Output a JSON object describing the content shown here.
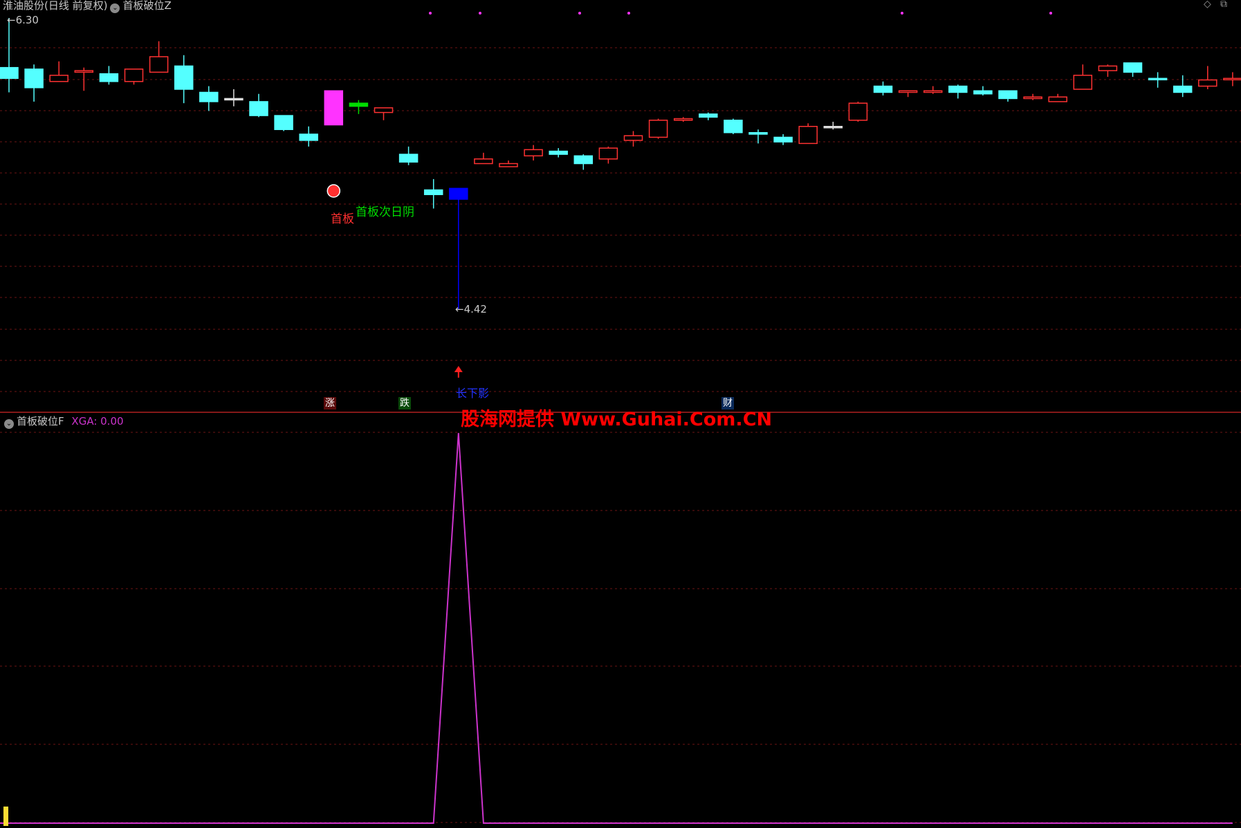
{
  "main_panel": {
    "stock_title": "淮油股份(日线 前复权)",
    "indicator_name": "首板破位Z",
    "high_label": "6.30",
    "low_label": "4.42",
    "annotations": {
      "first_board": "首板",
      "next_day_down": "首板次日阴",
      "long_lower_shadow": "长下影"
    },
    "event_tags": {
      "up": "涨",
      "down": "跌",
      "finance": "财"
    }
  },
  "sub_panel": {
    "indicator_name": "首板破位F",
    "value_label": "XGA: 0.00"
  },
  "watermark": "股海网提供 Www.Guhai.Com.CN",
  "colors": {
    "background": "#000000",
    "up_candle": "#ff3232",
    "down_candle": "#54ffff",
    "limit_up_board": "#ff33ff",
    "next_day_down": "#00dd00",
    "long_shadow": "#0000ff",
    "indicator_line": "#cc33cc",
    "grid": "#8b1a1a",
    "watermark": "#ff0000"
  },
  "chart_data": [
    {
      "type": "candlestick",
      "title": "淮油股份(日线 前复权)",
      "price_range": [
        4.42,
        6.3
      ],
      "grid": true,
      "candles": [
        {
          "o": 5.98,
          "c": 5.91,
          "h": 6.3,
          "l": 5.82,
          "color": "cyan"
        },
        {
          "o": 5.97,
          "c": 5.85,
          "h": 6.0,
          "l": 5.76,
          "color": "cyan"
        },
        {
          "o": 5.89,
          "c": 5.93,
          "h": 6.02,
          "l": 5.89,
          "color": "red"
        },
        {
          "o": 5.95,
          "c": 5.96,
          "h": 5.98,
          "l": 5.83,
          "color": "red"
        },
        {
          "o": 5.94,
          "c": 5.89,
          "h": 5.99,
          "l": 5.87,
          "color": "cyan"
        },
        {
          "o": 5.89,
          "c": 5.97,
          "h": 5.97,
          "l": 5.87,
          "color": "red"
        },
        {
          "o": 5.95,
          "c": 6.05,
          "h": 6.15,
          "l": 5.95,
          "color": "red"
        },
        {
          "o": 5.99,
          "c": 5.84,
          "h": 6.06,
          "l": 5.75,
          "color": "cyan"
        },
        {
          "o": 5.82,
          "c": 5.76,
          "h": 5.86,
          "l": 5.7,
          "color": "cyan"
        },
        {
          "o": 5.78,
          "c": 5.78,
          "h": 5.84,
          "l": 5.73,
          "color": "white"
        },
        {
          "o": 5.76,
          "c": 5.67,
          "h": 5.81,
          "l": 5.66,
          "color": "cyan"
        },
        {
          "o": 5.67,
          "c": 5.58,
          "h": 5.67,
          "l": 5.57,
          "color": "cyan"
        },
        {
          "o": 5.55,
          "c": 5.51,
          "h": 5.6,
          "l": 5.47,
          "color": "cyan"
        },
        {
          "o": 5.61,
          "c": 5.83,
          "h": 5.83,
          "l": 5.61,
          "color": "magenta",
          "label": "首板"
        },
        {
          "o": 5.75,
          "c": 5.73,
          "h": 5.77,
          "l": 5.68,
          "color": "green",
          "label": "首板次日阴"
        },
        {
          "o": 5.69,
          "c": 5.72,
          "h": 5.72,
          "l": 5.64,
          "color": "red"
        },
        {
          "o": 5.42,
          "c": 5.37,
          "h": 5.47,
          "l": 5.35,
          "color": "cyan"
        },
        {
          "o": 5.19,
          "c": 5.16,
          "h": 5.26,
          "l": 5.07,
          "color": "cyan"
        },
        {
          "o": 5.2,
          "c": 5.13,
          "h": 5.2,
          "l": 4.42,
          "color": "blue",
          "label": "长下影"
        },
        {
          "o": 5.36,
          "c": 5.39,
          "h": 5.43,
          "l": 5.36,
          "color": "red"
        },
        {
          "o": 5.34,
          "c": 5.36,
          "h": 5.38,
          "l": 5.34,
          "color": "red"
        },
        {
          "o": 5.41,
          "c": 5.45,
          "h": 5.48,
          "l": 5.38,
          "color": "red"
        },
        {
          "o": 5.44,
          "c": 5.42,
          "h": 5.46,
          "l": 5.4,
          "color": "cyan"
        },
        {
          "o": 5.41,
          "c": 5.36,
          "h": 5.42,
          "l": 5.32,
          "color": "cyan"
        },
        {
          "o": 5.39,
          "c": 5.46,
          "h": 5.47,
          "l": 5.36,
          "color": "red"
        },
        {
          "o": 5.51,
          "c": 5.54,
          "h": 5.57,
          "l": 5.47,
          "color": "red"
        },
        {
          "o": 5.53,
          "c": 5.64,
          "h": 5.65,
          "l": 5.52,
          "color": "red"
        },
        {
          "o": 5.64,
          "c": 5.65,
          "h": 5.66,
          "l": 5.63,
          "color": "red"
        },
        {
          "o": 5.68,
          "c": 5.66,
          "h": 5.69,
          "l": 5.64,
          "color": "cyan"
        },
        {
          "o": 5.64,
          "c": 5.56,
          "h": 5.65,
          "l": 5.55,
          "color": "cyan"
        },
        {
          "o": 5.56,
          "c": 5.55,
          "h": 5.58,
          "l": 5.49,
          "color": "cyan"
        },
        {
          "o": 5.53,
          "c": 5.5,
          "h": 5.55,
          "l": 5.48,
          "color": "cyan"
        },
        {
          "o": 5.49,
          "c": 5.6,
          "h": 5.62,
          "l": 5.49,
          "color": "red"
        },
        {
          "o": 5.6,
          "c": 5.6,
          "h": 5.63,
          "l": 5.58,
          "color": "white"
        },
        {
          "o": 5.64,
          "c": 5.75,
          "h": 5.76,
          "l": 5.63,
          "color": "red"
        },
        {
          "o": 5.86,
          "c": 5.82,
          "h": 5.89,
          "l": 5.8,
          "color": "cyan"
        },
        {
          "o": 5.82,
          "c": 5.83,
          "h": 5.83,
          "l": 5.79,
          "color": "red"
        },
        {
          "o": 5.82,
          "c": 5.83,
          "h": 5.86,
          "l": 5.81,
          "color": "red"
        },
        {
          "o": 5.86,
          "c": 5.82,
          "h": 5.87,
          "l": 5.78,
          "color": "cyan"
        },
        {
          "o": 5.83,
          "c": 5.81,
          "h": 5.86,
          "l": 5.8,
          "color": "cyan"
        },
        {
          "o": 5.83,
          "c": 5.78,
          "h": 5.83,
          "l": 5.76,
          "color": "cyan"
        },
        {
          "o": 5.78,
          "c": 5.79,
          "h": 5.81,
          "l": 5.77,
          "color": "red"
        },
        {
          "o": 5.76,
          "c": 5.79,
          "h": 5.81,
          "l": 5.76,
          "color": "red"
        },
        {
          "o": 5.84,
          "c": 5.93,
          "h": 6.0,
          "l": 5.84,
          "color": "red"
        },
        {
          "o": 5.96,
          "c": 5.99,
          "h": 6.0,
          "l": 5.92,
          "color": "red"
        },
        {
          "o": 6.01,
          "c": 5.95,
          "h": 6.01,
          "l": 5.92,
          "color": "cyan"
        },
        {
          "o": 5.91,
          "c": 5.91,
          "h": 5.95,
          "l": 5.85,
          "color": "cyan"
        },
        {
          "o": 5.86,
          "c": 5.82,
          "h": 5.93,
          "l": 5.79,
          "color": "cyan"
        },
        {
          "o": 5.86,
          "c": 5.9,
          "h": 5.99,
          "l": 5.84,
          "color": "red"
        },
        {
          "o": 5.91,
          "c": 5.91,
          "h": 5.95,
          "l": 5.86,
          "color": "red"
        }
      ]
    },
    {
      "type": "line",
      "title": "首板破位F",
      "series": [
        {
          "name": "XGA",
          "values": [
            0,
            0,
            0,
            0,
            0,
            0,
            0,
            0,
            0,
            0,
            0,
            0,
            0,
            0,
            0,
            0,
            0,
            0,
            1,
            0,
            0,
            0,
            0,
            0,
            0,
            0,
            0,
            0,
            0,
            0,
            0,
            0,
            0,
            0,
            0,
            0,
            0,
            0,
            0,
            0,
            0,
            0,
            0,
            0,
            0,
            0,
            0,
            0,
            0,
            0
          ]
        }
      ],
      "ylim": [
        0,
        1
      ]
    }
  ]
}
